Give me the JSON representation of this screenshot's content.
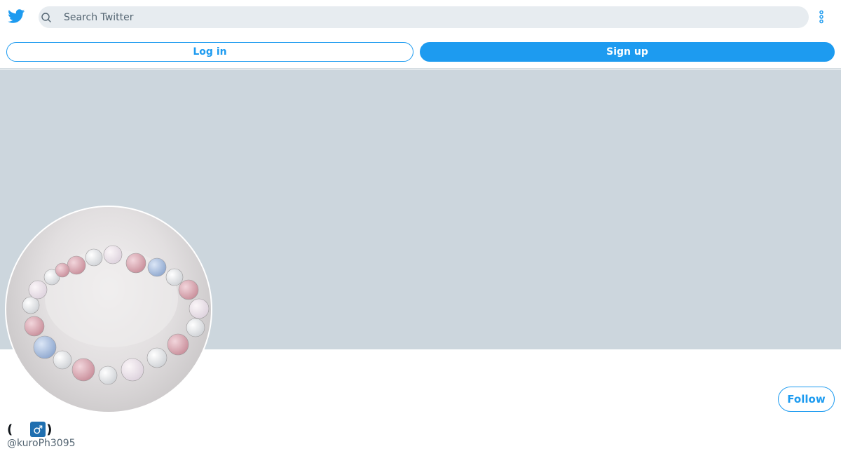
{
  "header": {
    "logo_icon": "twitter-bird-icon",
    "search": {
      "placeholder": "Search Twitter",
      "value": ""
    },
    "more_icon": "more-vertical-icon"
  },
  "auth": {
    "login_label": "Log in",
    "signup_label": "Sign up"
  },
  "profile": {
    "banner_color": "#ccd6dd",
    "follow_label": "Follow",
    "name_prefix": "(",
    "name_badge": "♂",
    "name_suffix": ")",
    "handle": "@kuroPh3095"
  },
  "colors": {
    "accent": "#1d9bf0",
    "search_bg": "#e7ecf0",
    "divider": "#cfd9de"
  }
}
